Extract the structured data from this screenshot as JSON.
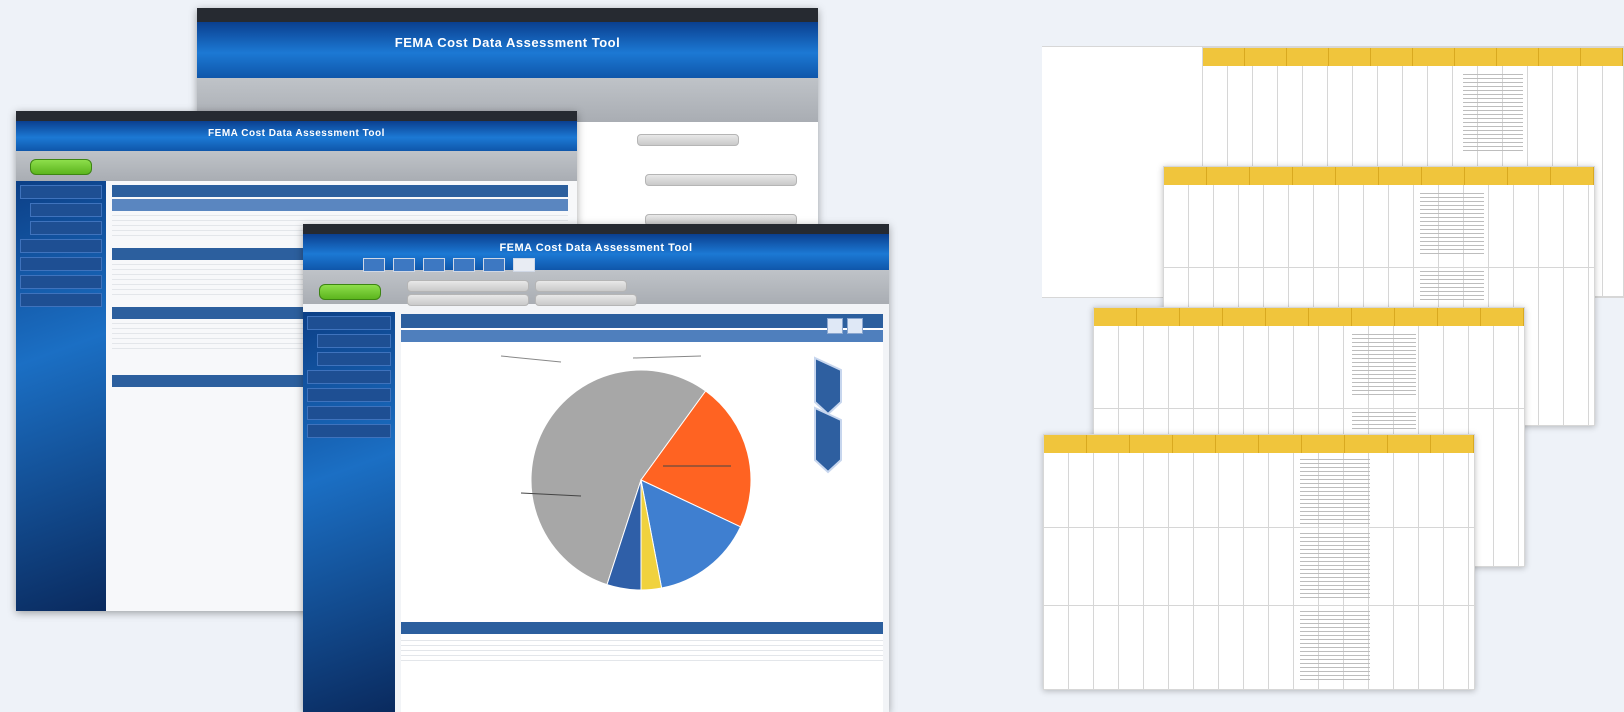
{
  "windows": {
    "back": {
      "title": "FEMA Cost Data Assessment Tool"
    },
    "middle": {
      "title": "FEMA Cost Data Assessment Tool",
      "button": ""
    },
    "front": {
      "title": "FEMA Cost Data Assessment Tool",
      "button": ""
    }
  },
  "chart_data": {
    "type": "pie",
    "title": "",
    "values": [
      55,
      22,
      15,
      3,
      5
    ],
    "colors": [
      "#a7a7a7",
      "#ff6322",
      "#3f7fd0",
      "#f0d23e",
      "#2f5fa8"
    ],
    "start_angle": 108
  },
  "colors": {
    "accent": "#1c79d4",
    "sheet_header": "#f0c53c",
    "button_green": "#5cb51e"
  }
}
